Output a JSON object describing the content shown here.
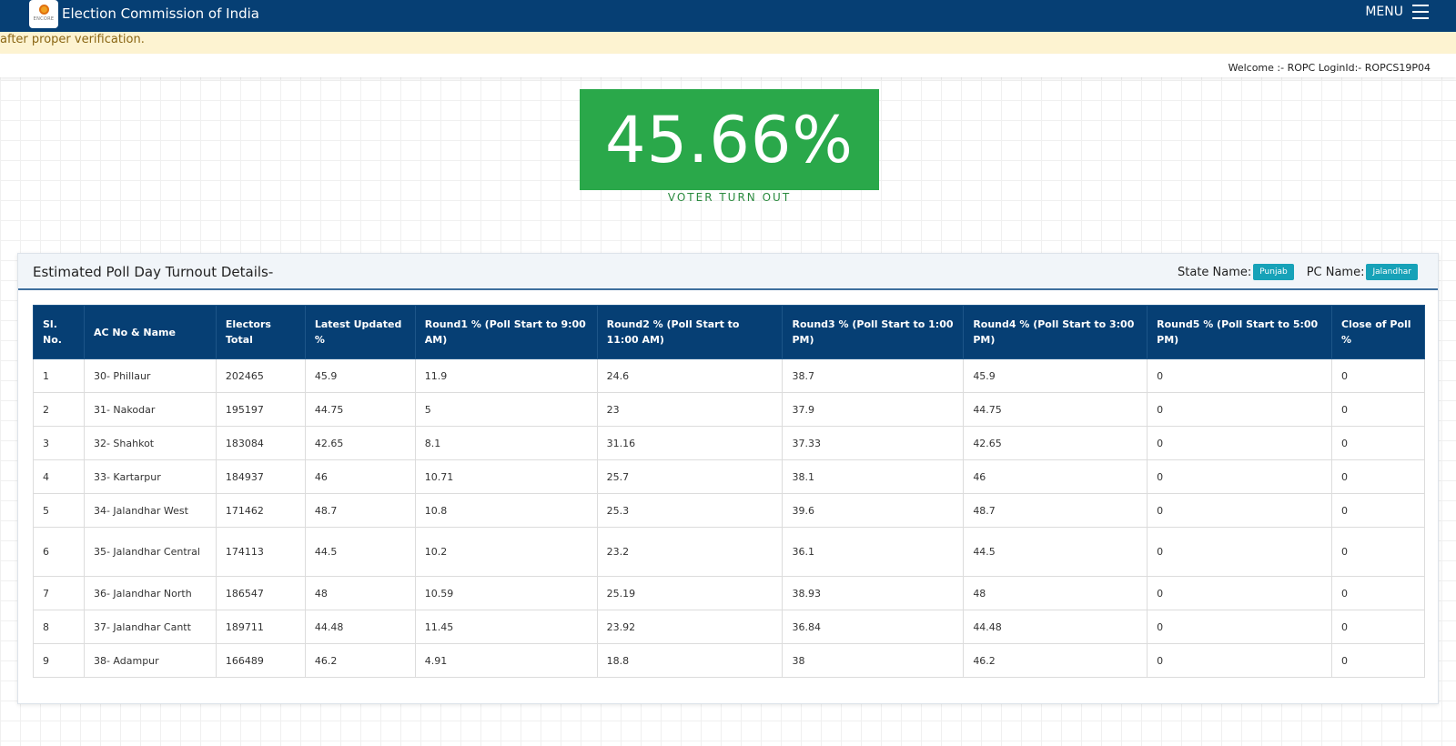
{
  "header": {
    "logo_text": "ENCORE",
    "title": "Election Commission of India",
    "menu_label": "MENU"
  },
  "notice": {
    "text": "after proper verification."
  },
  "welcome": {
    "text": "Welcome :- ROPC LoginId:- ROPCS19P04"
  },
  "turnout": {
    "value": "45.66%",
    "label": "VOTER TURN OUT"
  },
  "panel": {
    "title": "Estimated Poll Day Turnout Details-",
    "state_label": "State Name:",
    "state_value": "Punjab",
    "pc_label": "PC Name:",
    "pc_value": "Jalandhar"
  },
  "table": {
    "columns": [
      "Sl. No.",
      "AC No & Name",
      "Electors Total",
      "Latest Updated %",
      "Round1 % (Poll Start to 9:00 AM)",
      "Round2 % (Poll Start to 11:00 AM)",
      "Round3 % (Poll Start to 1:00 PM)",
      "Round4 % (Poll Start to 3:00 PM)",
      "Round5 % (Poll Start to 5:00 PM)",
      "Close of Poll %"
    ],
    "rows": [
      [
        "1",
        "30- Phillaur",
        "202465",
        "45.9",
        "11.9",
        "24.6",
        "38.7",
        "45.9",
        "0",
        "0"
      ],
      [
        "2",
        "31- Nakodar",
        "195197",
        "44.75",
        "5",
        "23",
        "37.9",
        "44.75",
        "0",
        "0"
      ],
      [
        "3",
        "32- Shahkot",
        "183084",
        "42.65",
        "8.1",
        "31.16",
        "37.33",
        "42.65",
        "0",
        "0"
      ],
      [
        "4",
        "33- Kartarpur",
        "184937",
        "46",
        "10.71",
        "25.7",
        "38.1",
        "46",
        "0",
        "0"
      ],
      [
        "5",
        "34- Jalandhar West",
        "171462",
        "48.7",
        "10.8",
        "25.3",
        "39.6",
        "48.7",
        "0",
        "0"
      ],
      [
        "6",
        "35- Jalandhar Central",
        "174113",
        "44.5",
        "10.2",
        "23.2",
        "36.1",
        "44.5",
        "0",
        "0"
      ],
      [
        "7",
        "36- Jalandhar North",
        "186547",
        "48",
        "10.59",
        "25.19",
        "38.93",
        "48",
        "0",
        "0"
      ],
      [
        "8",
        "37- Jalandhar Cantt",
        "189711",
        "44.48",
        "11.45",
        "23.92",
        "36.84",
        "44.48",
        "0",
        "0"
      ],
      [
        "9",
        "38- Adampur",
        "166489",
        "46.2",
        "4.91",
        "18.8",
        "38",
        "46.2",
        "0",
        "0"
      ]
    ]
  }
}
